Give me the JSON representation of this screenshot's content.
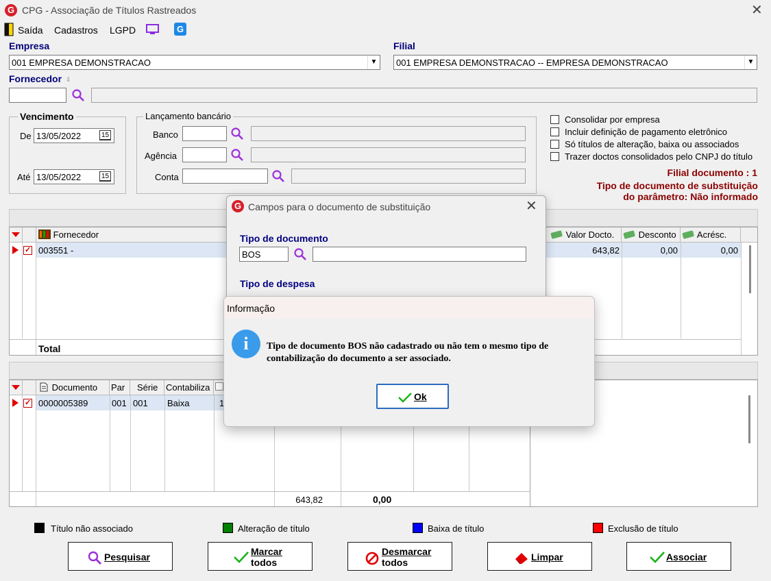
{
  "window": {
    "title": "CPG - Associação de Títulos Rastreados"
  },
  "menu": {
    "saida": "Saída",
    "cadastros": "Cadastros",
    "lgpd": "LGPD"
  },
  "empresa": {
    "label": "Empresa",
    "value": "001 EMPRESA DEMONSTRACAO"
  },
  "filial": {
    "label": "Filial",
    "value": "001 EMPRESA DEMONSTRACAO -- EMPRESA DEMONSTRACAO"
  },
  "fornecedor": {
    "label": "Fornecedor",
    "code": "",
    "name": ""
  },
  "vencimento": {
    "title": "Vencimento",
    "de_label": "De",
    "de_value": "13/05/2022",
    "ate_label": "Até",
    "ate_value": "13/05/2022",
    "calendar_glyph": "15"
  },
  "lancamento": {
    "title": "Lançamento bancário",
    "banco": "Banco",
    "agencia": "Agência",
    "conta": "Conta"
  },
  "options": [
    {
      "label": "Consolidar por empresa",
      "checked": false
    },
    {
      "label": "Incluir definição de pagamento eletrônico",
      "checked": false
    },
    {
      "label": "Só títulos de alteração, baixa ou associados",
      "checked": false
    },
    {
      "label": "Trazer doctos consolidados pelo CNPJ do título",
      "checked": false
    }
  ],
  "info": {
    "filial_documento": "Filial documento : 1",
    "tipo_line1": "Tipo de documento de substituição",
    "tipo_line2": "do parâmetro: Não informado"
  },
  "grid1": {
    "headers": {
      "fornecedor": "Fornecedor",
      "valor": "Valor Docto.",
      "desconto": "Desconto",
      "acresc": "Acrésc."
    },
    "row": {
      "fornecedor": "003551 -",
      "valor": "643,82",
      "desconto": "0,00",
      "acresc": "0,00"
    },
    "total_label": "Total"
  },
  "grid2": {
    "headers": {
      "documento": "Documento",
      "par": "Par",
      "serie": "Série",
      "contabiliza": "Contabiliza"
    },
    "row": {
      "documento": "0000005389",
      "par": "001",
      "serie": "001",
      "contabiliza": "Baixa",
      "extra": "1"
    },
    "footer": {
      "valor": "643,82",
      "outro": "0,00"
    }
  },
  "legend": {
    "nao_associado": "Título não associado",
    "alteracao": "Alteração de título",
    "baixa": "Baixa de título",
    "exclusao": "Exclusão de título",
    "colors": {
      "nao_associado": "#000000",
      "alteracao": "#008000",
      "baixa": "#0000ff",
      "exclusao": "#ff0000"
    }
  },
  "buttons": {
    "pesquisar": "Pesquisar",
    "marcar_1": "Marcar",
    "marcar_2": "todos",
    "desmarcar_1": "Desmarcar",
    "desmarcar_2": "todos",
    "limpar": "Limpar",
    "associar": "Associar"
  },
  "substituicao": {
    "title": "Campos para o documento de substituição",
    "tipo_documento_label": "Tipo de documento",
    "tipo_documento_value": "BOS",
    "tipo_despesa_label": "Tipo de  despesa"
  },
  "msgbox": {
    "title": "Informação",
    "line1": "Tipo de documento BOS não cadastrado ou não tem o mesmo tipo de",
    "line2": "contabilização do documento a ser associado.",
    "ok": "Ok"
  }
}
